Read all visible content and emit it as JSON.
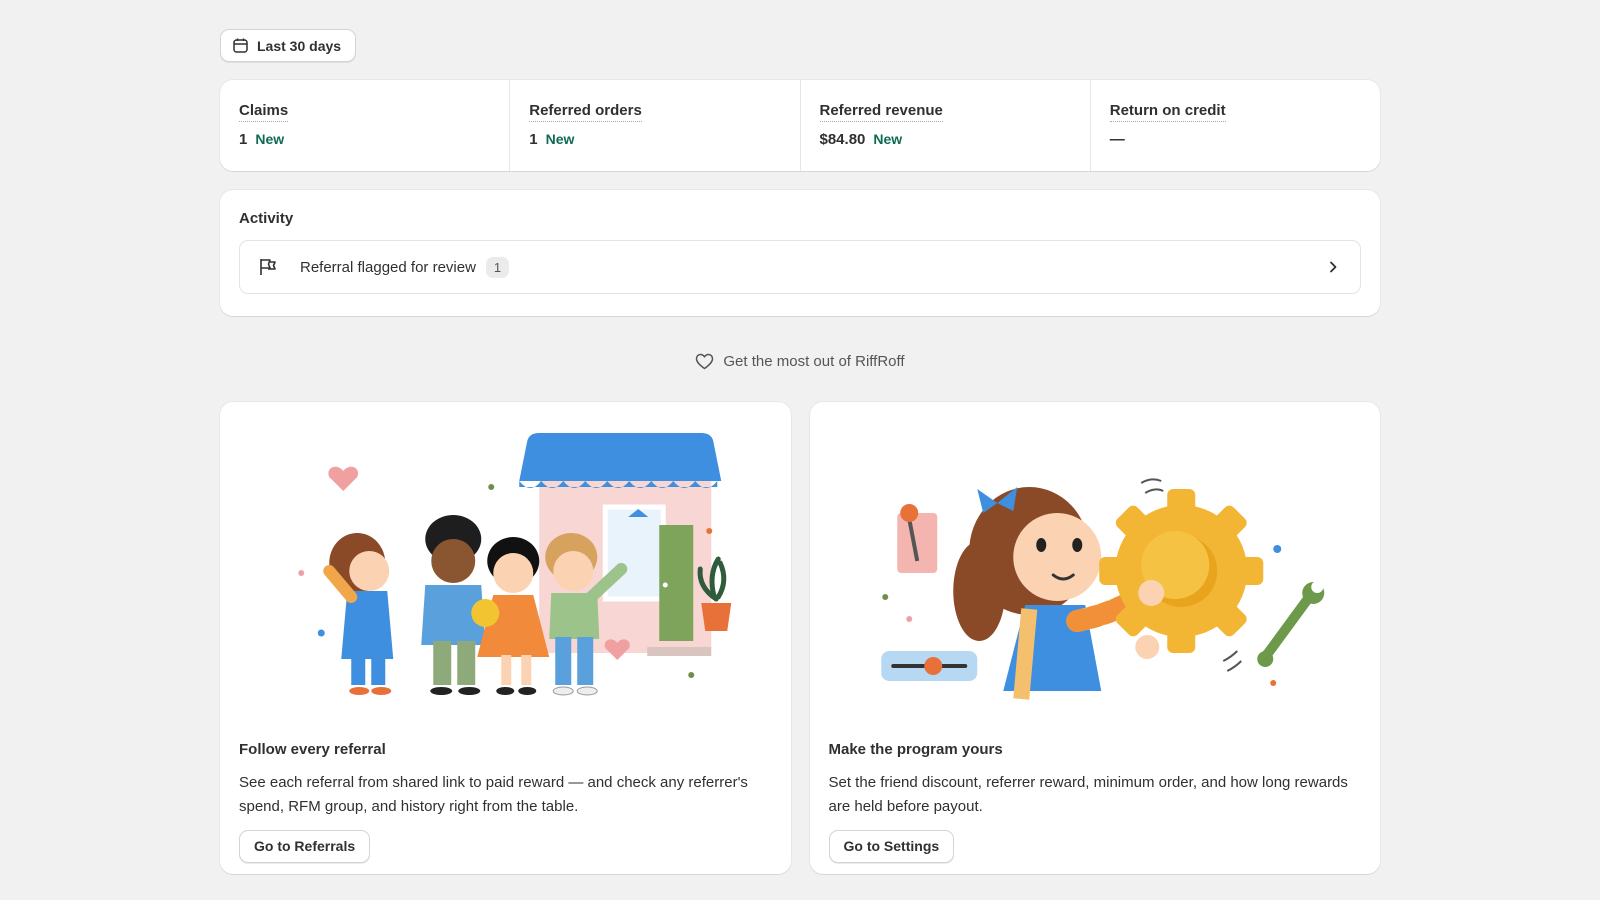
{
  "filter": {
    "date_range_label": "Last 30 days"
  },
  "metrics": [
    {
      "label": "Claims",
      "value": "1",
      "badge": "New"
    },
    {
      "label": "Referred orders",
      "value": "1",
      "badge": "New"
    },
    {
      "label": "Referred revenue",
      "value": "$84.80",
      "badge": "New"
    },
    {
      "label": "Return on credit",
      "value": "—",
      "badge": ""
    }
  ],
  "activity": {
    "title": "Activity",
    "items": [
      {
        "label": "Referral flagged for review",
        "count": "1",
        "icon": "flag-icon"
      }
    ]
  },
  "tip": {
    "text": "Get the most out of RiffRoff",
    "icon": "heart-icon"
  },
  "features": [
    {
      "title": "Follow every referral",
      "description": "See each referral from shared link to paid reward — and check any referrer's spend, RFM group, and history right from the table.",
      "button_label": "Go to Referrals"
    },
    {
      "title": "Make the program yours",
      "description": "Set the friend discount, referrer reward, minimum order, and how long rewards are held before payout.",
      "button_label": "Go to Settings"
    }
  ],
  "colors": {
    "page_bg": "#f1f1f1",
    "accent_green": "#0f6b53",
    "awning_blue": "#3f8fe0",
    "gear_yellow": "#f2b634"
  }
}
